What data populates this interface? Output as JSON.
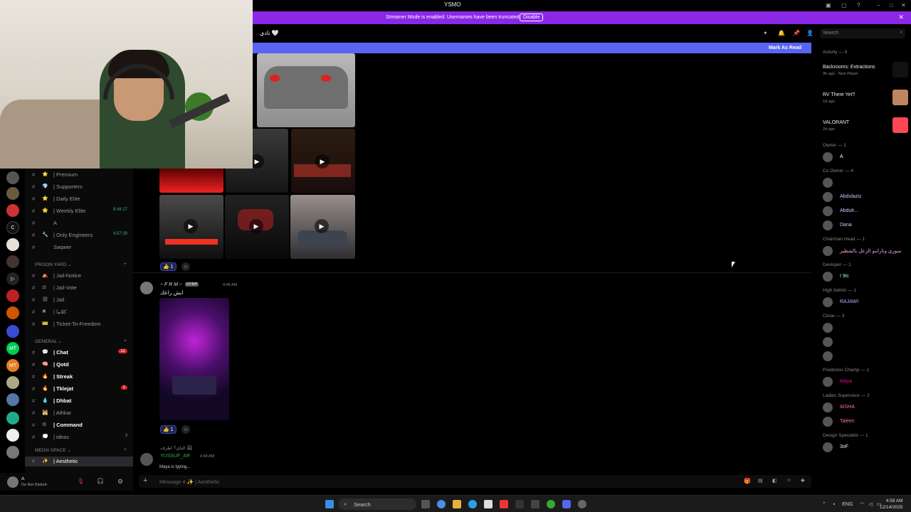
{
  "window": {
    "title": "YSMO"
  },
  "banner": {
    "message": "Streamer Mode is enabled. Usernames have been truncated.",
    "disable_label": "Disable"
  },
  "header": {
    "channel_title": "نادي 🤍",
    "search_placeholder": "Search"
  },
  "mark_as_read": "Mark As Read",
  "channels": {
    "top": [
      {
        "icon": "⭐",
        "name": "| Premium"
      },
      {
        "icon": "💎",
        "name": "| Supporters"
      },
      {
        "icon": "⭐",
        "name": "| Daily Elite"
      },
      {
        "icon": "🌟",
        "name": "| Weekly Elite",
        "time": "8:48:17"
      },
      {
        "icon": "",
        "name": "A"
      },
      {
        "icon": "🔧",
        "name": "| Only Engineers",
        "time": "4:57:39"
      },
      {
        "icon": "",
        "name": "Saqwer"
      }
    ],
    "prison_yard": {
      "label": "PRISON YARD",
      "items": [
        {
          "icon": "⛺",
          "name": "| Jail-Notice"
        },
        {
          "icon": "⚖",
          "name": "| Jail-Vote"
        },
        {
          "icon": "⛓",
          "name": "| Jail"
        },
        {
          "icon": "✖",
          "name": "| كلاما"
        },
        {
          "icon": "🎫",
          "name": "| Ticket-To-Freedom"
        }
      ]
    },
    "general": {
      "label": "GENERAL",
      "items": [
        {
          "icon": "💬",
          "name": "| Chat",
          "badge": "12",
          "bold": true
        },
        {
          "icon": "🧠",
          "name": "| Qotd",
          "bold": true
        },
        {
          "icon": "🔥",
          "name": "| Streak",
          "bold": true
        },
        {
          "icon": "🔥",
          "name": "| Tklejat",
          "badge": "1",
          "bold": true
        },
        {
          "icon": "💧",
          "name": "| Dhbat",
          "bold": true
        },
        {
          "icon": "🕌",
          "name": "| Athkar"
        },
        {
          "icon": "⚙",
          "name": "| Command",
          "bold": true
        },
        {
          "icon": "💭",
          "name": "| ideas",
          "count": "3"
        }
      ]
    },
    "media_space": {
      "label": "MEDIA SPACE",
      "items": [
        {
          "icon": "✨",
          "name": "| Aesthetic"
        }
      ]
    }
  },
  "messages": [
    {
      "author": "~ F R M ~",
      "tag": "OTRP",
      "time": "4:48 AM",
      "text": "ابش راعك",
      "reaction_count": "1"
    },
    {
      "first_reaction_count": "1"
    }
  ],
  "reply": {
    "author": "YUSSUF_AR",
    "time": "4:48 AM",
    "reply_text": "الناي؟ اطرف 🖼"
  },
  "typing": "Maya is typing...",
  "composer": {
    "placeholder": "Message # ✨ | Aesthetic"
  },
  "user": {
    "name": "A",
    "status": "Do Not Disturb"
  },
  "members": {
    "activity_header": "Activity — 9",
    "activities": [
      {
        "name": "Backrooms: Extractions",
        "sub": "9h ago · New Player",
        "thumb_color": "#111111"
      },
      {
        "name": "RV There Yet?",
        "sub": "1d ago",
        "thumb_color": "#c08560"
      },
      {
        "name": "VALORANT",
        "sub": "2d ago",
        "thumb_color": "#ff4655"
      }
    ],
    "groups": [
      {
        "header": "Owner — 1",
        "members": [
          "A"
        ]
      },
      {
        "header": "Co Owner — 4",
        "members": [
          "",
          "Abdulaziz",
          "Abdulr...",
          "Dana"
        ]
      },
      {
        "header": "Chairman Head — 1",
        "members": [
          "منوري وناراتبو الزعل بالشطير"
        ]
      },
      {
        "header": "Devloper — 1",
        "members": [
          "⁣I 9ic"
        ]
      },
      {
        "header": "High Admin — 1",
        "members": [
          "RAJAWI"
        ]
      },
      {
        "header": "Close — 3",
        "members": [
          "",
          "",
          ""
        ]
      },
      {
        "header": "Prediction Champ — 1",
        "members": [
          "Maya"
        ]
      },
      {
        "header": "Ladies Supervisor — 2",
        "members": [
          "AISHA",
          "Taleen"
        ]
      },
      {
        "header": "Design Specialist — 1",
        "members": [
          "3oF"
        ]
      }
    ]
  },
  "taskbar": {
    "search": "Search",
    "lang": "ENG",
    "time": "4:59 AM",
    "date": "12/14/2025"
  }
}
